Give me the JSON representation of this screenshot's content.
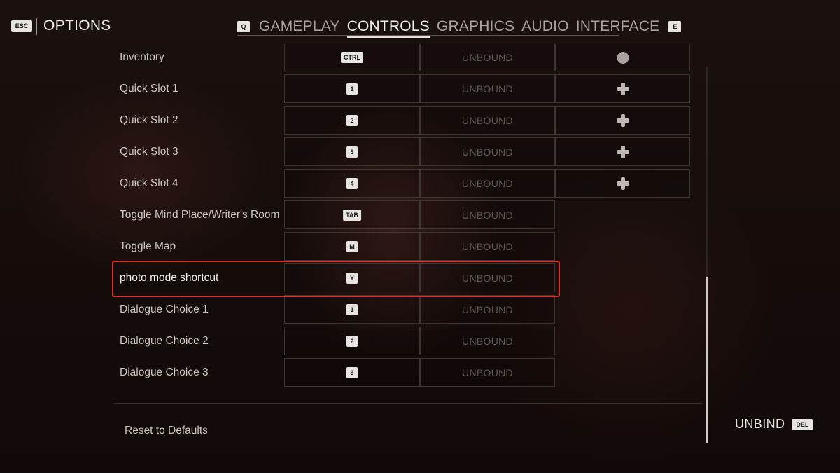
{
  "header": {
    "back_key": "ESC",
    "title": "OPTIONS",
    "prev_tab_key": "Q",
    "next_tab_key": "E",
    "tabs": [
      {
        "label": "GAMEPLAY",
        "active": false
      },
      {
        "label": "CONTROLS",
        "active": true
      },
      {
        "label": "GRAPHICS",
        "active": false
      },
      {
        "label": "AUDIO",
        "active": false
      },
      {
        "label": "INTERFACE",
        "active": false
      }
    ]
  },
  "bindings": {
    "unbound_text": "UNBOUND",
    "rows": [
      {
        "label": "Inventory",
        "key": "CTRL",
        "alt": "UNBOUND",
        "pad": "circle-icon"
      },
      {
        "label": "Quick Slot 1",
        "key": "1",
        "alt": "UNBOUND",
        "pad": "dpad-icon"
      },
      {
        "label": "Quick Slot 2",
        "key": "2",
        "alt": "UNBOUND",
        "pad": "dpad-icon"
      },
      {
        "label": "Quick Slot 3",
        "key": "3",
        "alt": "UNBOUND",
        "pad": "dpad-icon"
      },
      {
        "label": "Quick Slot 4",
        "key": "4",
        "alt": "UNBOUND",
        "pad": "dpad-icon"
      },
      {
        "label": "Toggle Mind Place/Writer's Room",
        "key": "TAB",
        "alt": "UNBOUND",
        "pad": ""
      },
      {
        "label": "Toggle Map",
        "key": "M",
        "alt": "UNBOUND",
        "pad": ""
      },
      {
        "label": "photo mode shortcut",
        "key": "Y",
        "alt": "UNBOUND",
        "pad": "",
        "selected": true
      },
      {
        "label": "Dialogue Choice 1",
        "key": "1",
        "alt": "UNBOUND",
        "pad": ""
      },
      {
        "label": "Dialogue Choice 2",
        "key": "2",
        "alt": "UNBOUND",
        "pad": ""
      },
      {
        "label": "Dialogue Choice 3",
        "key": "3",
        "alt": "UNBOUND",
        "pad": ""
      }
    ]
  },
  "footer": {
    "reset_label": "Reset to Defaults",
    "unbind_label": "UNBIND",
    "unbind_key": "DEL"
  },
  "colors": {
    "highlight": "#d8322c",
    "accent_text": "#f4f1ee"
  }
}
